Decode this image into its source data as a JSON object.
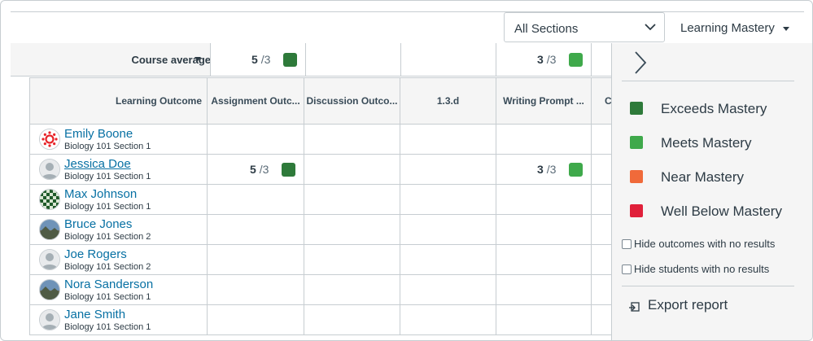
{
  "toolbar": {
    "section_select": {
      "selected": "All Sections"
    },
    "gradebook_menu": {
      "label": "Learning Mastery"
    }
  },
  "course_average": {
    "label": "Course average",
    "cells": [
      {
        "score": "5",
        "denominator": "/3",
        "color": "#2e7a3a"
      },
      null,
      null,
      {
        "score": "3",
        "denominator": "/3",
        "color": "#3fa94b"
      },
      null
    ]
  },
  "columns": {
    "learning_outcome": "Learning Outcome",
    "headers": [
      "Assignment Outc...",
      "Discussion Outco...",
      "1.3.d",
      "Writing Prompt ...",
      "C"
    ]
  },
  "students": [
    {
      "name": "Emily Boone",
      "section": "Biology 101 Section 1",
      "avatar": "canvas-logo-avatar",
      "scores": [
        null,
        null,
        null,
        null
      ]
    },
    {
      "name": "Jessica Doe",
      "section": "Biology 101 Section 1",
      "avatar": "default-avatar",
      "scores": [
        {
          "score": "5",
          "denominator": "/3",
          "color": "#2e7a3a"
        },
        null,
        null,
        {
          "score": "3",
          "denominator": "/3",
          "color": "#3fa94b"
        }
      ]
    },
    {
      "name": "Max Johnson",
      "section": "Biology 101 Section 1",
      "avatar": "pattern-photo-avatar",
      "scores": [
        null,
        null,
        null,
        null
      ]
    },
    {
      "name": "Bruce Jones",
      "section": "Biology 101 Section 2",
      "avatar": "landscape-photo-avatar",
      "scores": [
        null,
        null,
        null,
        null
      ]
    },
    {
      "name": "Joe Rogers",
      "section": "Biology 101 Section 2",
      "avatar": "default-avatar",
      "scores": [
        null,
        null,
        null,
        null
      ]
    },
    {
      "name": "Nora Sanderson",
      "section": "Biology 101 Section 1",
      "avatar": "landscape-photo-avatar",
      "scores": [
        null,
        null,
        null,
        null
      ]
    },
    {
      "name": "Jane Smith",
      "section": "Biology 101 Section 1",
      "avatar": "default-avatar",
      "scores": [
        null,
        null,
        null,
        null
      ]
    }
  ],
  "panel": {
    "collapse_icon": "chevron-right-icon",
    "legend": [
      {
        "label": "Exceeds Mastery",
        "color": "#2e7a3a"
      },
      {
        "label": "Meets Mastery",
        "color": "#3fa94b"
      },
      {
        "label": "Near Mastery",
        "color": "#f06a3a"
      },
      {
        "label": "Well Below Mastery",
        "color": "#e0203a"
      }
    ],
    "filters": [
      {
        "label": "Hide outcomes with no results",
        "checked": false
      },
      {
        "label": "Hide students with no results",
        "checked": false
      }
    ],
    "export": {
      "label": "Export report",
      "icon": "export-icon"
    }
  }
}
